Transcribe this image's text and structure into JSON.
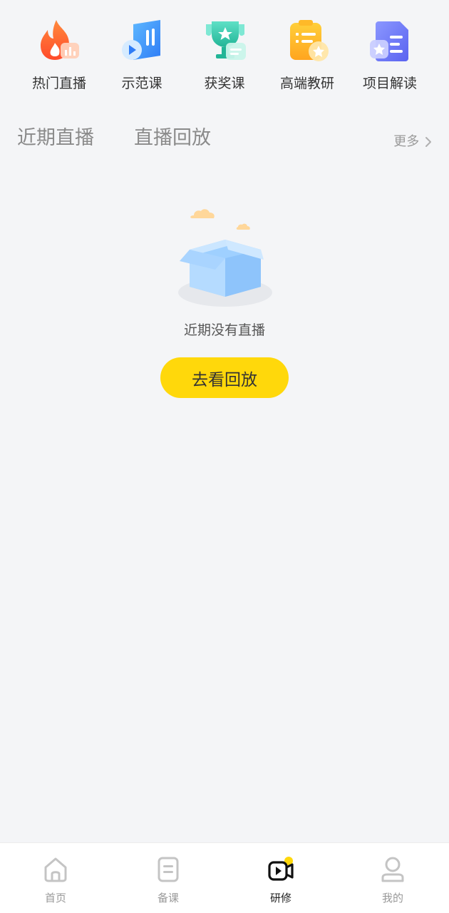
{
  "quick_entries": [
    {
      "label": "热门直播",
      "icon": "flame-chart-icon"
    },
    {
      "label": "示范课",
      "icon": "video-play-icon"
    },
    {
      "label": "获奖课",
      "icon": "trophy-icon"
    },
    {
      "label": "高端教研",
      "icon": "clipboard-star-icon"
    },
    {
      "label": "项目解读",
      "icon": "document-star-icon"
    }
  ],
  "tabs": {
    "recent_live": "近期直播",
    "replay": "直播回放",
    "more": "更多"
  },
  "empty_state": {
    "message": "近期没有直播",
    "button": "去看回放"
  },
  "bottom_nav": [
    {
      "label": "首页",
      "icon": "home-icon",
      "active": false
    },
    {
      "label": "备课",
      "icon": "lesson-doc-icon",
      "active": false
    },
    {
      "label": "研修",
      "icon": "video-camera-icon",
      "active": true
    },
    {
      "label": "我的",
      "icon": "user-icon",
      "active": false
    }
  ],
  "colors": {
    "accent": "#ffd80b",
    "background": "#f4f5f7",
    "nav_background": "#ffffff"
  }
}
